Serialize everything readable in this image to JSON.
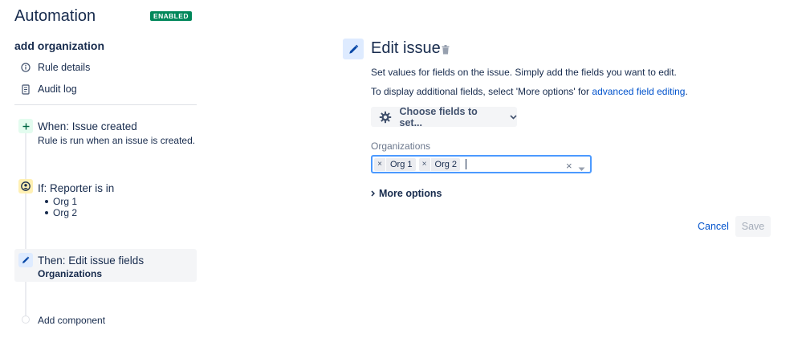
{
  "app": {
    "title": "Automation",
    "status_badge": "ENABLED"
  },
  "rule": {
    "name": "add organization"
  },
  "nav": [
    {
      "label": "Rule details",
      "icon": "info-icon"
    },
    {
      "label": "Audit log",
      "icon": "document-icon"
    }
  ],
  "steps": {
    "when": {
      "title": "When: Issue created",
      "subtitle": "Rule is run when an issue is created.",
      "icon": "plus-icon"
    },
    "if": {
      "title": "If: Reporter is in",
      "items": [
        "Org 1",
        "Org 2"
      ],
      "icon": "user-circle-icon"
    },
    "then": {
      "title": "Then: Edit issue fields",
      "subtitle": "Organizations",
      "icon": "pencil-icon"
    },
    "add": {
      "label": "Add component"
    }
  },
  "panel": {
    "title": "Edit issue",
    "desc1": "Set values for fields on the issue. Simply add the fields you want to edit.",
    "desc2_prefix": "To display additional fields, select 'More options' for ",
    "desc2_link": "advanced field editing",
    "desc2_suffix": ".",
    "choose_label": "Choose fields to set...",
    "field_label": "Organizations",
    "selected": [
      "Org 1",
      "Org 2"
    ],
    "more_options": "More options",
    "cancel": "Cancel",
    "save": "Save"
  },
  "colors": {
    "accent": "#0052cc",
    "badge": "#00875a",
    "focus": "#4c9aff"
  }
}
